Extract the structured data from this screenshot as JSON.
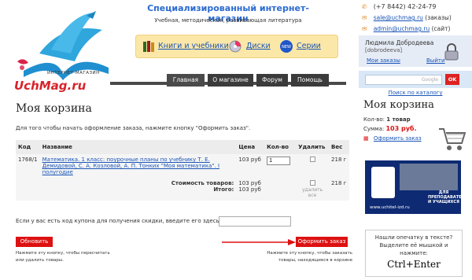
{
  "header": {
    "logo_tag": "ИНТЕРНЕТ-МАГАЗИН",
    "logo_text": "UchMag.ru",
    "site_title": "Специализированный интернет-магазин",
    "site_subtitle": "Учебная, методическая, развивающая литература",
    "nav_links": [
      {
        "label": "Книги и учебники",
        "icon": "books-icon"
      },
      {
        "label": "Диски",
        "icon": "disc-icon"
      },
      {
        "label": "Серии",
        "icon": "new-badge-icon"
      }
    ],
    "tabs": [
      "Главная",
      "О магазине",
      "Форум",
      "Помощь"
    ]
  },
  "contacts": {
    "phone": "(+7 8442) 42-24-79",
    "email_orders": "sale@uchmag.ru",
    "email_orders_note": "(заказы)",
    "email_admin": "admin@uchmag.ru",
    "email_admin_note": "(сайт)"
  },
  "user": {
    "name": "Людмила Добродеева",
    "login": "[dobrodeeva]",
    "my_orders": "Мои заказы",
    "logout": "Выйти"
  },
  "search": {
    "placeholder": "Google",
    "button": "OK",
    "catalog_link": "Поиск по каталогу"
  },
  "side_cart": {
    "title": "Моя корзина",
    "qty_label": "Кол-во:",
    "qty_value": "1 товар",
    "sum_label": "Сумма:",
    "sum_value": "103 руб.",
    "checkout_link": "Оформить заказ"
  },
  "banner": {
    "label": "ДЛЯ ПРЕПОДАВАТЕЛЕЙ И УЧАЩИХСЯ",
    "url": "www.uchitel-izd.ru"
  },
  "typo": {
    "line1": "Нашли опечатку в тексте?",
    "line2": "Выделите её мышкой и нажмите:",
    "keys": "Ctrl+Enter"
  },
  "cart": {
    "title": "Моя корзина",
    "intro": "Для того чтобы начать оформление заказа, нажмите кнопку \"Оформить заказ\".",
    "columns": [
      "Код",
      "Название",
      "Цена",
      "Кол-во",
      "Удалить",
      "Вес"
    ],
    "rows": [
      {
        "code": "1768/1",
        "name": "Математика. 1 класс: поурочные планы по учебнику Т. Е. Демидовой, С. А. Козловой, А. П. Тонких \"Моя математика\". I полугодие",
        "price": "103 руб",
        "qty": "1",
        "weight": "218 г"
      }
    ],
    "totals": {
      "goods_label": "Стоимость товаров:",
      "goods_value": "103 руб",
      "total_label": "Итого:",
      "total_value": "103 руб",
      "weight": "218 г",
      "delete_all": "удалить все"
    },
    "coupon_text": "Если у вас есть код купона для получения скидки, введите его здесь:",
    "update_button": "Обновить",
    "update_note_1": "Нажмите эту кнопку, чтобы пересчитать",
    "update_note_2": "или удалить товары.",
    "order_button": "Оформить заказ",
    "order_note_1": "Нажмите эту кнопку, чтобы заказать",
    "order_note_2": "товары, находящиеся в корзине"
  },
  "colors": {
    "accent_red": "#dd1111",
    "link_blue": "#1a55b8",
    "title_blue": "#2a6ad0",
    "nav_yellow": "#fbe7a8"
  }
}
